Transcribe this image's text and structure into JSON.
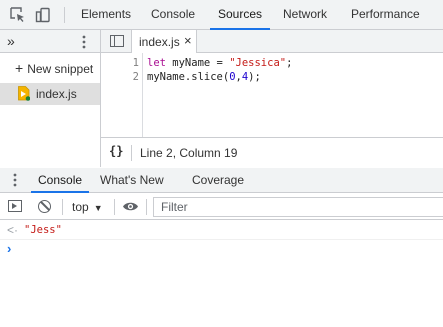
{
  "top_tabs": {
    "inspect_icon": "inspect-element-icon",
    "device_icon": "device-toolbar-icon",
    "items": [
      {
        "label": "Elements",
        "active": false
      },
      {
        "label": "Console",
        "active": false
      },
      {
        "label": "Sources",
        "active": true
      },
      {
        "label": "Network",
        "active": false
      },
      {
        "label": "Performance",
        "active": false
      }
    ]
  },
  "navigator": {
    "more_icon": "chevron-double-right-icon",
    "more_symbol": "»",
    "kebab_icon": "kebab-menu-icon",
    "new_snippet_label": "New snippet",
    "plus_symbol": "+",
    "files": [
      {
        "name": "index.js",
        "icon": "snippet-file-icon"
      }
    ]
  },
  "editor": {
    "toggle_icon": "toggle-navigator-icon",
    "tab_label": "index.js",
    "close_symbol": "×",
    "lines": [
      {
        "number": "1",
        "code": "let myName = \"Jessica\";"
      },
      {
        "number": "2",
        "code": "myName.slice(0,4);"
      }
    ],
    "status": {
      "pretty_print": "{}",
      "position": "Line 2, Column 19"
    }
  },
  "drawer": {
    "kebab_icon": "kebab-menu-icon",
    "tabs": [
      {
        "label": "Console",
        "active": true
      },
      {
        "label": "What's New",
        "active": false
      },
      {
        "label": "Coverage",
        "active": false
      }
    ]
  },
  "console_toolbar": {
    "sidebar_icon": "show-sidebar-icon",
    "clear_icon": "clear-console-icon",
    "context": "top",
    "context_caret": "▼",
    "eye_icon": "live-expression-eye-icon",
    "filter_placeholder": "Filter",
    "filter_value": ""
  },
  "console": {
    "result_arrow": "<·",
    "result_value": "\"Jess\"",
    "prompt": "›"
  },
  "colors": {
    "accent": "#1a73e8",
    "string": "#c41a16",
    "keyword": "#a90d91"
  }
}
